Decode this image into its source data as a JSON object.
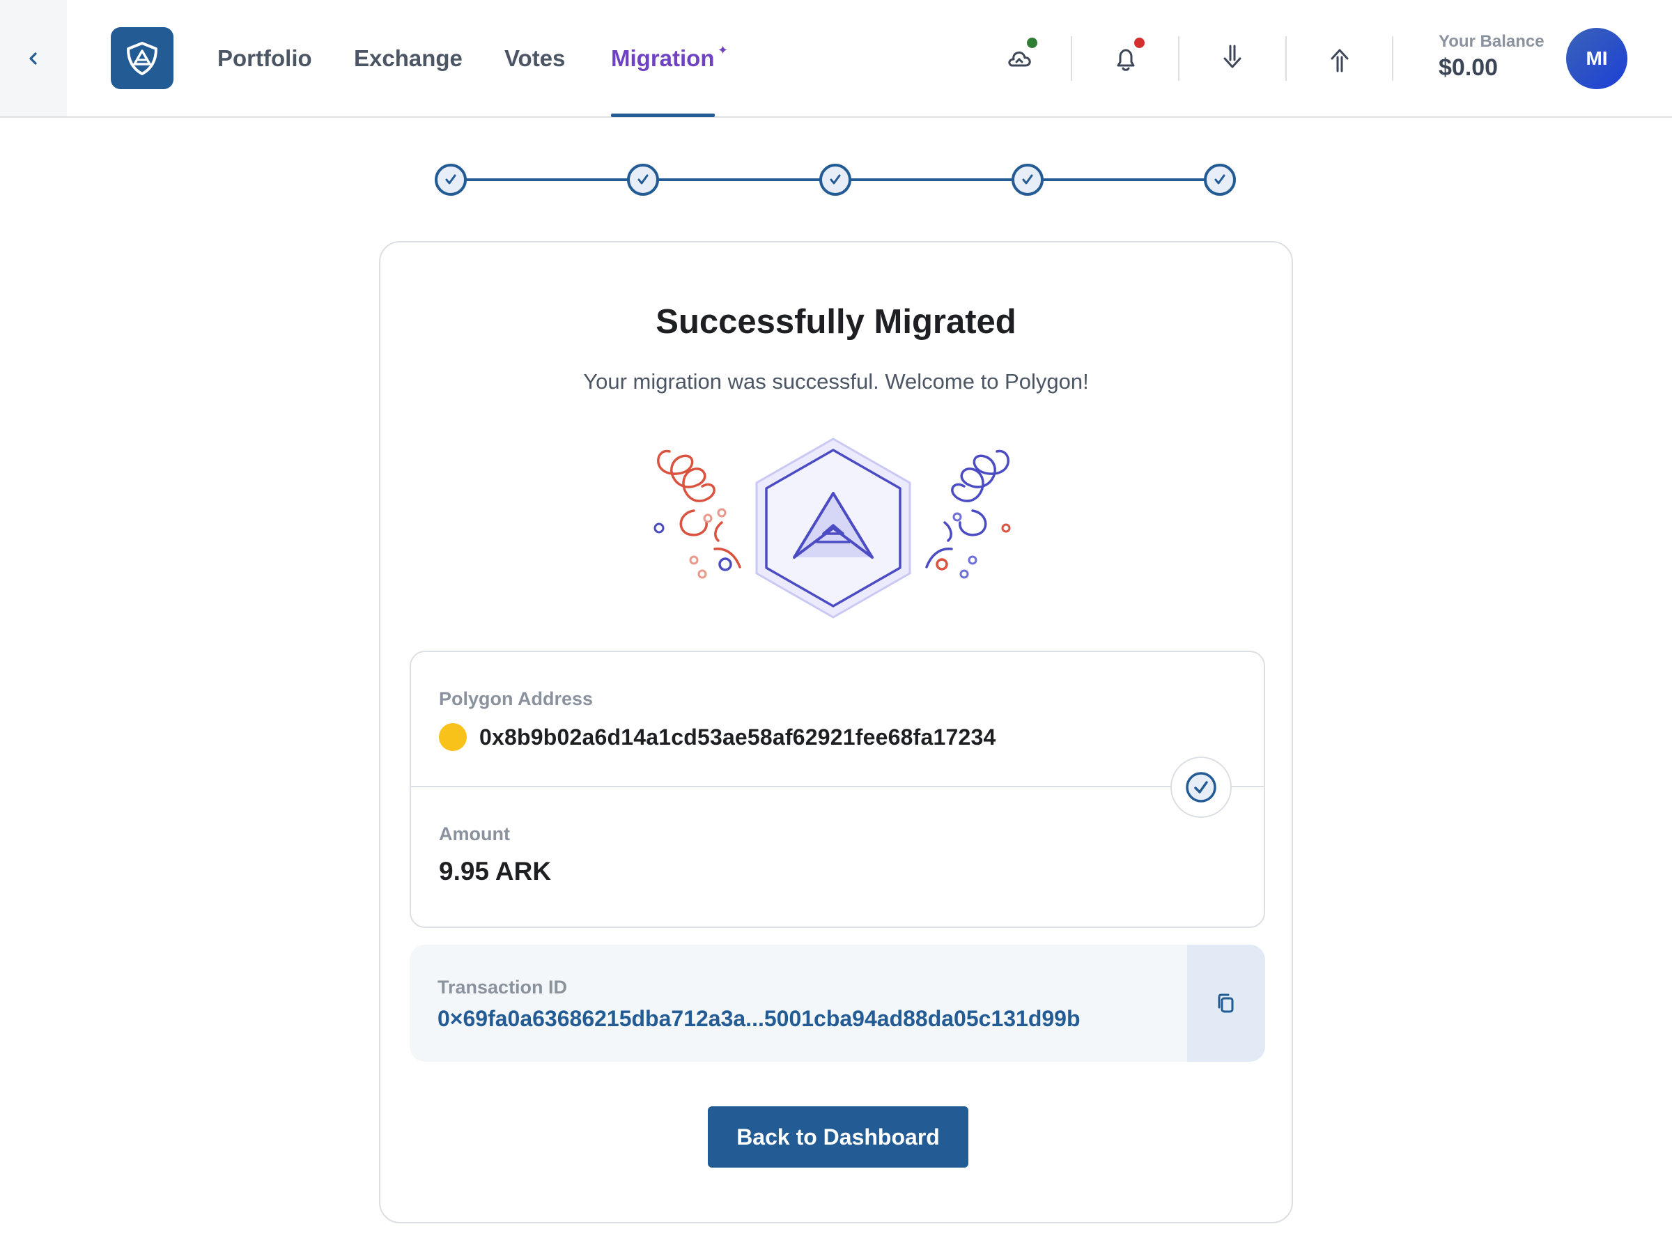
{
  "header": {
    "nav": [
      {
        "label": "Portfolio"
      },
      {
        "label": "Exchange"
      },
      {
        "label": "Votes"
      },
      {
        "label": "Migration",
        "active": true
      }
    ],
    "icons": [
      "chevron-left-icon",
      "app-logo",
      "cloud-sync-icon",
      "bell-icon",
      "receive-icon",
      "send-icon"
    ],
    "balance_label": "Your Balance",
    "balance_value": "$0.00",
    "avatar_initials": "MI"
  },
  "stepper": {
    "total_steps": 5,
    "completed_steps": 5
  },
  "result": {
    "title": "Successfully Migrated",
    "subtitle": "Your migration was successful. Welcome to Polygon!",
    "address_label": "Polygon Address",
    "address_value": "0x8b9b02a6d14a1cd53ae58af62921fee68fa17234",
    "amount_label": "Amount",
    "amount_value": "9.95 ARK",
    "transaction_label": "Transaction ID",
    "transaction_value": "0×69fa0a63686215dba712a3a...5001cba94ad88da05c131d99b",
    "button_label": "Back to Dashboard"
  },
  "colors": {
    "primary": "#235b95",
    "accent_purple": "#6f42c1",
    "success_dot": "#2e7d32",
    "alert_dot": "#d32f2f",
    "coin": "#f8c21b",
    "confetti_red": "#d9533f",
    "confetti_blue": "#4b4cc4"
  }
}
